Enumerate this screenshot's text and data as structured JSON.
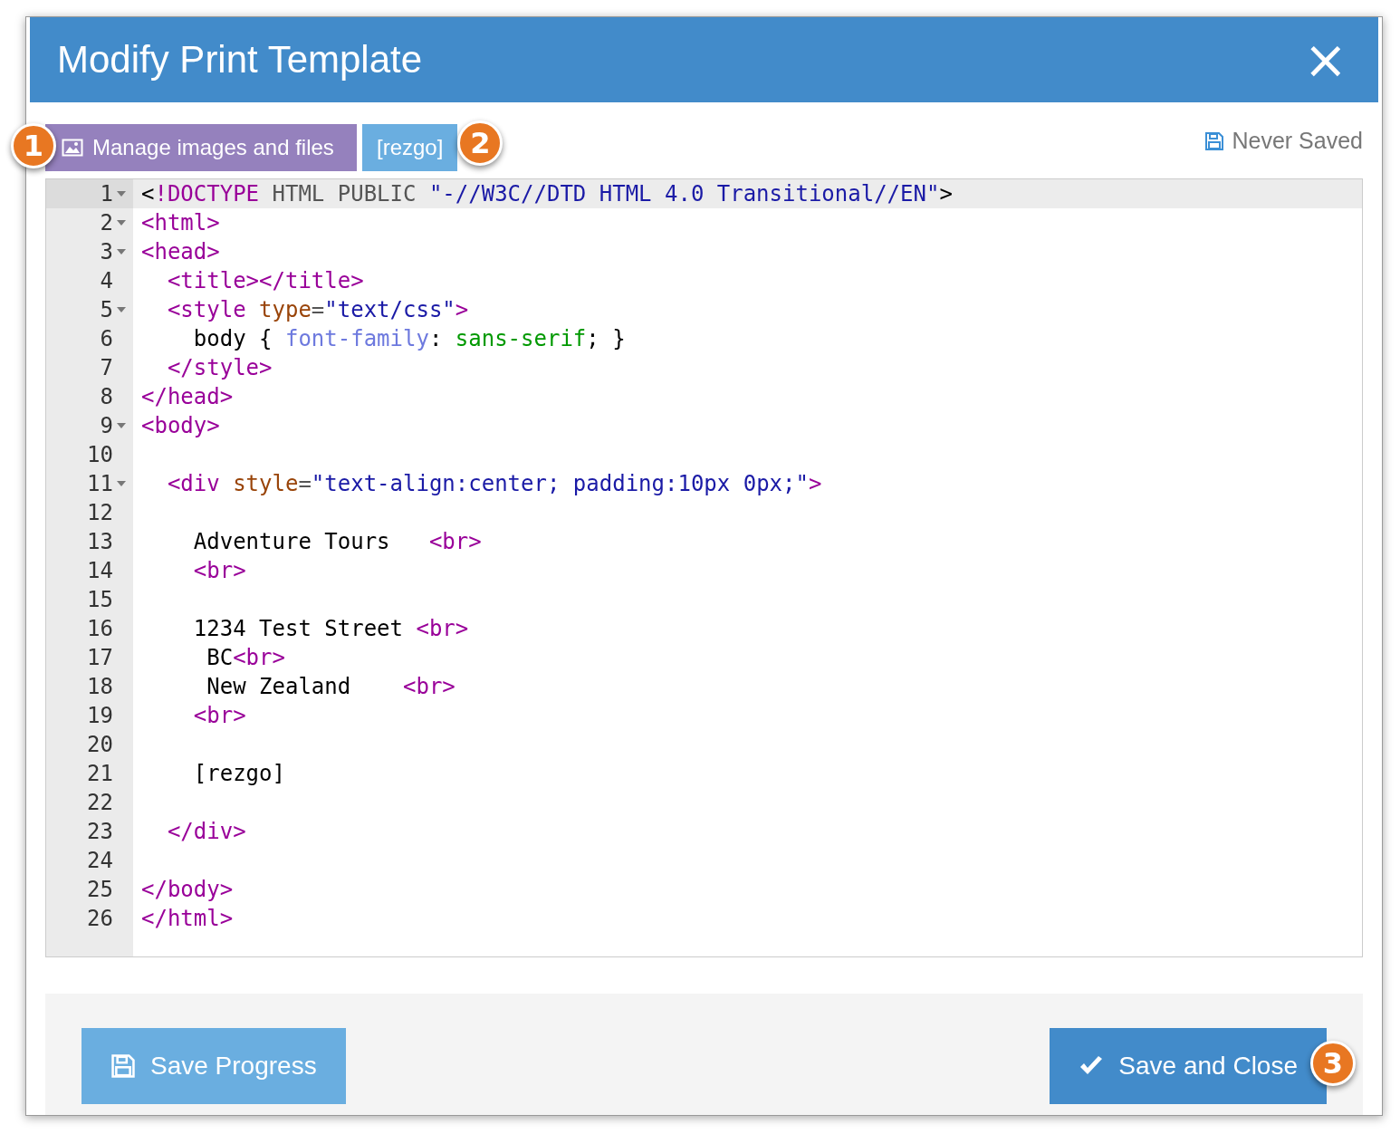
{
  "window": {
    "title": "Modify Print Template",
    "close": "×"
  },
  "toolbar": {
    "buttons": [
      {
        "label": "Manage images and files",
        "kind": "images",
        "callout": "1"
      },
      {
        "label": "[rezgo]",
        "kind": "plain",
        "callout": "2"
      }
    ],
    "save_status": "Never Saved"
  },
  "editor": {
    "lines": [
      {
        "number": "1",
        "foldable": true,
        "active": true,
        "tokens": [
          {
            "t": "<",
            "kind": "plain"
          },
          {
            "t": "!DOCTYPE",
            "kind": "tag"
          },
          {
            "t": " HTML PUBLIC ",
            "kind": "meta"
          },
          {
            "t": "\"-//W3C//DTD HTML 4.0 Transitional//EN\"",
            "kind": "string"
          },
          {
            "t": ">",
            "kind": "plain"
          }
        ]
      },
      {
        "number": "2",
        "foldable": true,
        "active": false,
        "tokens": [
          {
            "t": "<html>",
            "kind": "tag"
          }
        ]
      },
      {
        "number": "3",
        "foldable": true,
        "active": false,
        "tokens": [
          {
            "t": "<head>",
            "kind": "tag"
          }
        ]
      },
      {
        "number": "4",
        "foldable": false,
        "active": false,
        "tokens": [
          {
            "t": "  <title></title>",
            "kind": "tag"
          }
        ]
      },
      {
        "number": "5",
        "foldable": true,
        "active": false,
        "tokens": [
          {
            "t": "  <style",
            "kind": "tag"
          },
          {
            "t": " type",
            "kind": "attr"
          },
          {
            "t": "=",
            "kind": "meta"
          },
          {
            "t": "\"text/css\"",
            "kind": "string"
          },
          {
            "t": ">",
            "kind": "tag"
          }
        ]
      },
      {
        "number": "6",
        "foldable": false,
        "active": false,
        "tokens": [
          {
            "t": "    body { ",
            "kind": "plain"
          },
          {
            "t": "font-family",
            "kind": "property"
          },
          {
            "t": ": ",
            "kind": "plain"
          },
          {
            "t": "sans-serif",
            "kind": "value"
          },
          {
            "t": "; }",
            "kind": "plain"
          }
        ]
      },
      {
        "number": "7",
        "foldable": false,
        "active": false,
        "tokens": [
          {
            "t": "  </style>",
            "kind": "tag"
          }
        ]
      },
      {
        "number": "8",
        "foldable": false,
        "active": false,
        "tokens": [
          {
            "t": "</head>",
            "kind": "tag"
          }
        ]
      },
      {
        "number": "9",
        "foldable": true,
        "active": false,
        "tokens": [
          {
            "t": "<body>",
            "kind": "tag"
          }
        ]
      },
      {
        "number": "10",
        "foldable": false,
        "active": false
      },
      {
        "number": "11",
        "foldable": true,
        "active": false,
        "tokens": [
          {
            "t": "  <div",
            "kind": "tag"
          },
          {
            "t": " style",
            "kind": "attr"
          },
          {
            "t": "=",
            "kind": "meta"
          },
          {
            "t": "\"text-align:center; padding:10px 0px;\"",
            "kind": "string"
          },
          {
            "t": ">",
            "kind": "tag"
          }
        ]
      },
      {
        "number": "12",
        "foldable": false,
        "active": false
      },
      {
        "number": "13",
        "foldable": false,
        "active": false,
        "tokens": [
          {
            "t": "    Adventure Tours   ",
            "kind": "plain"
          },
          {
            "t": "<br>",
            "kind": "tag"
          }
        ]
      },
      {
        "number": "14",
        "foldable": false,
        "active": false,
        "tokens": [
          {
            "t": "    <br>",
            "kind": "tag"
          }
        ]
      },
      {
        "number": "15",
        "foldable": false,
        "active": false
      },
      {
        "number": "16",
        "foldable": false,
        "active": false,
        "tokens": [
          {
            "t": "    1234 Test Street ",
            "kind": "plain"
          },
          {
            "t": "<br>",
            "kind": "tag"
          }
        ]
      },
      {
        "number": "17",
        "foldable": false,
        "active": false,
        "tokens": [
          {
            "t": "     BC",
            "kind": "plain"
          },
          {
            "t": "<br>",
            "kind": "tag"
          }
        ]
      },
      {
        "number": "18",
        "foldable": false,
        "active": false,
        "tokens": [
          {
            "t": "     New Zealand    ",
            "kind": "plain"
          },
          {
            "t": "<br>",
            "kind": "tag"
          }
        ]
      },
      {
        "number": "19",
        "foldable": false,
        "active": false,
        "tokens": [
          {
            "t": "    <br>",
            "kind": "tag"
          }
        ]
      },
      {
        "number": "20",
        "foldable": false,
        "active": false
      },
      {
        "number": "21",
        "foldable": false,
        "active": false,
        "tokens": [
          {
            "t": "    [rezgo]",
            "kind": "plain"
          }
        ]
      },
      {
        "number": "22",
        "foldable": false,
        "active": false
      },
      {
        "number": "23",
        "foldable": false,
        "active": false,
        "tokens": [
          {
            "t": "  </div>",
            "kind": "tag"
          }
        ]
      },
      {
        "number": "24",
        "foldable": false,
        "active": false
      },
      {
        "number": "25",
        "foldable": false,
        "active": false,
        "tokens": [
          {
            "t": "</body>",
            "kind": "tag"
          }
        ]
      },
      {
        "number": "26",
        "foldable": false,
        "active": false,
        "tokens": [
          {
            "t": "</html>",
            "kind": "tag"
          }
        ]
      }
    ]
  },
  "footer": {
    "buttons": [
      {
        "label": "Save Progress",
        "kind": "save"
      },
      {
        "label": "Save and Close",
        "kind": "confirm",
        "callout": "3"
      }
    ]
  }
}
